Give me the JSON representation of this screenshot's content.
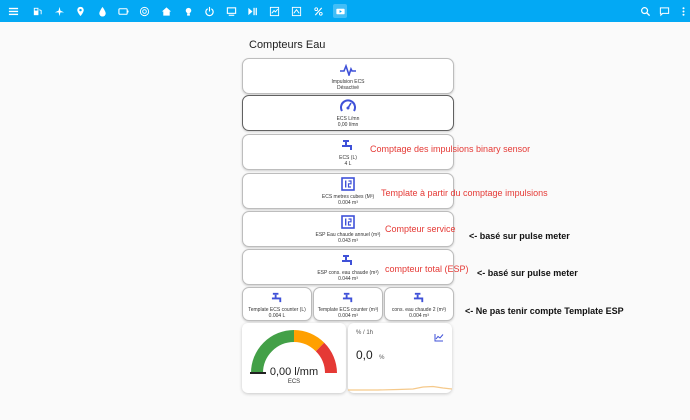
{
  "toolbar": {
    "nav_icons": [
      "flash-icon",
      "fuel-pump-icon",
      "airplane-icon",
      "map-marker-icon",
      "water-drop-icon",
      "battery-icon",
      "radar-icon",
      "home-icon",
      "light-icon",
      "power-icon",
      "monitor-icon",
      "play-pause-icon",
      "chart-edit-icon",
      "chart-upload-icon",
      "percent-icon",
      "video-icon"
    ],
    "right_icons": [
      "search-icon",
      "chat-icon",
      "more-icon"
    ]
  },
  "page": {
    "title": "Compteurs Eau"
  },
  "cards": [
    {
      "name": "Impulsion ECS",
      "state": "Désactivé",
      "icon": "pulse-icon"
    },
    {
      "name": "ECS L/mn",
      "state": "0,00 l/mn",
      "icon": "speedometer-icon"
    },
    {
      "name": "ECS (L)",
      "state": "4 L",
      "icon": "faucet-icon"
    },
    {
      "name": "ECS metres cubes (M³)",
      "state": "0.004 m³",
      "icon": "counter-icon"
    },
    {
      "name": "ESP Eau chaude annuel (m³)",
      "state": "0.043 m³",
      "icon": "counter-icon"
    },
    {
      "name": "ESP cons. eau chaude (m³)",
      "state": "0.044 m³",
      "icon": "faucet-icon"
    }
  ],
  "small_cards": [
    {
      "name": "Template ECS counter (L)",
      "state": "0.004 L",
      "icon": "faucet-icon"
    },
    {
      "name": "Template ECS counter (m³)",
      "state": "0.004 m³",
      "icon": "faucet-icon"
    },
    {
      "name": "cons. eau chaude 2 (m³)",
      "state": "0.004 m³",
      "icon": "faucet-icon"
    }
  ],
  "notes": {
    "n1": "Comptage des impulsions binary sensor",
    "n2": "Template à partir du comptage impulsions",
    "n3": "Compteur service",
    "n4": "<- basé sur pulse meter",
    "n5": "compteur total (ESP)",
    "n6": "<- basé sur pulse meter",
    "n7": "<- Ne pas tenir compte Template ESP"
  },
  "gauge": {
    "value": "0,00 l/mm",
    "name": "ECS",
    "level": 0,
    "colors": [
      "#43a047",
      "#ffa000",
      "#e53935"
    ]
  },
  "graph": {
    "title": "% / 1h",
    "value": "0,0",
    "unit": "%",
    "icon": "chart-line-icon",
    "line_color": "#f5c98b"
  },
  "colors": {
    "header": "#03a9f4",
    "icon": "#3f51d8",
    "note_red": "#e53935"
  }
}
